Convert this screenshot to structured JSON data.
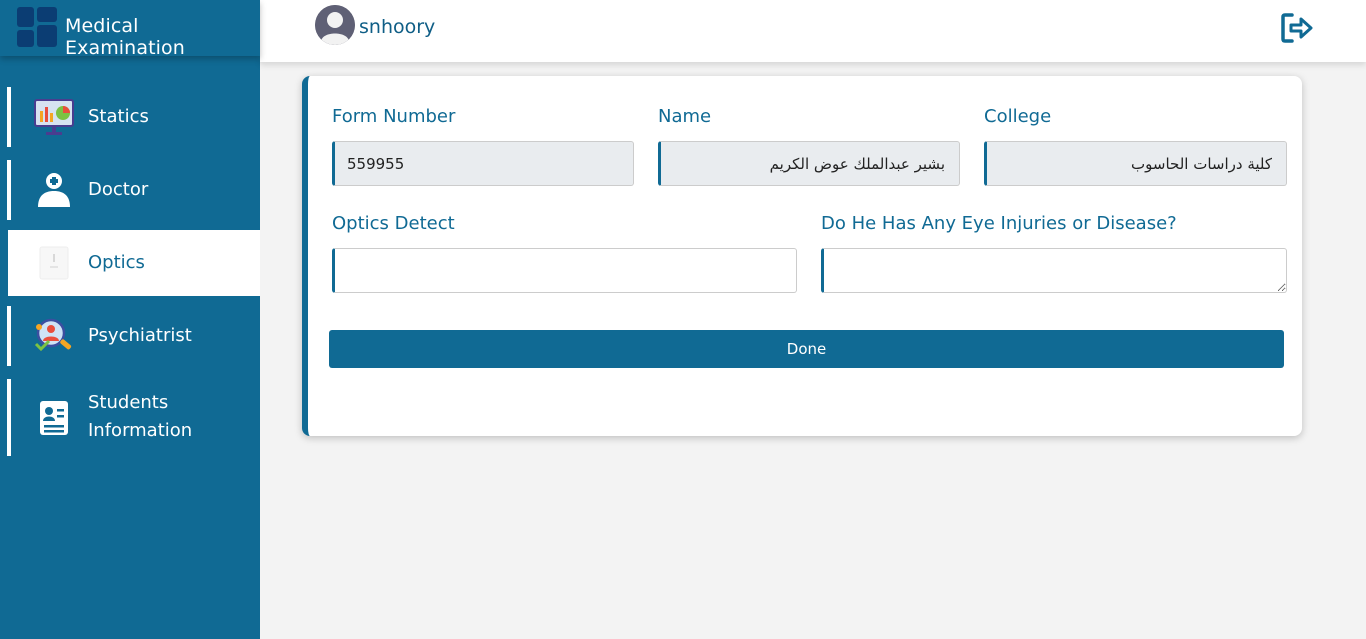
{
  "brand": {
    "title": "Medical Examination",
    "icon": "dashboard-grid-icon"
  },
  "user": {
    "name": "snhoory",
    "avatar_icon": "user-avatar-icon",
    "logout_icon": "logout-icon"
  },
  "sidebar": {
    "items": [
      {
        "label": "Statics",
        "icon": "statistics-board-icon",
        "active": false
      },
      {
        "label": "Doctor",
        "icon": "doctor-icon",
        "active": false
      },
      {
        "label": "Optics",
        "icon": "optics-icon",
        "active": true
      },
      {
        "label": "Psychiatrist",
        "icon": "psychiatrist-icon",
        "active": false
      },
      {
        "label": "Students",
        "label2": "Information",
        "icon": "student-id-card-icon",
        "active": false
      }
    ]
  },
  "form": {
    "form_number": {
      "label": "Form Number",
      "value": "559955"
    },
    "name": {
      "label": "Name",
      "value": "بشير عبدالملك عوض الكريم"
    },
    "college": {
      "label": "College",
      "value": "كلية دراسات الحاسوب"
    },
    "optics_detect": {
      "label": "Optics Detect",
      "value": ""
    },
    "eye_injuries": {
      "label": "Do He Has Any Eye Injuries or Disease?",
      "value": ""
    },
    "submit_label": "Done"
  },
  "colors": {
    "primary": "#106a94",
    "background": "#f3f3f3",
    "readonly_field": "#e9ecef"
  }
}
